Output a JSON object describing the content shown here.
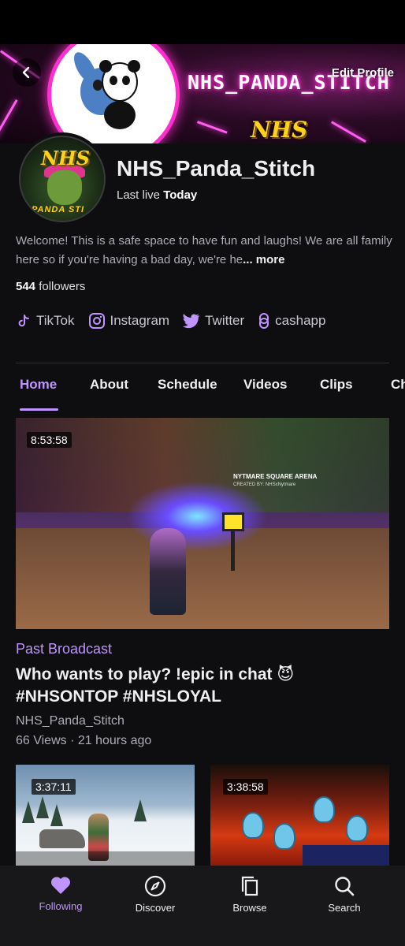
{
  "header": {
    "banner_title": "NHS_PANDA_STITCH",
    "banner_logo": "NHS",
    "back_icon": "chevron-left-icon",
    "edit_profile_label": "Edit Profile"
  },
  "channel": {
    "avatar_logo": "NHS",
    "avatar_caption": "PANDA STI",
    "name": "NHS_Panda_Stitch",
    "last_live_prefix": "Last live",
    "last_live_value": "Today",
    "bio": "Welcome! This is a safe space to have fun and laughs! We are all family here so if you're having a bad day, we're he",
    "bio_more": "... more",
    "followers_count": "544",
    "followers_label": "followers"
  },
  "socials": [
    {
      "label": "TikTok",
      "icon": "tiktok-icon"
    },
    {
      "label": "Instagram",
      "icon": "instagram-icon"
    },
    {
      "label": "Twitter",
      "icon": "twitter-icon"
    },
    {
      "label": "cashapp",
      "icon": "link-icon"
    }
  ],
  "tabs": [
    {
      "label": "Home",
      "active": true
    },
    {
      "label": "About"
    },
    {
      "label": "Schedule"
    },
    {
      "label": "Videos"
    },
    {
      "label": "Clips"
    },
    {
      "label": "Ch"
    }
  ],
  "featured_video": {
    "duration": "8:53:58",
    "overlay_title": "NYTMARE SQUARE ARENA",
    "overlay_sub": "CREATED BY: NHSxNytmare",
    "type_label": "Past Broadcast",
    "title": "Who wants to play?  !epic in chat 😈 #NHSONTOP #NHSLOYAL",
    "channel": "NHS_Panda_Stitch",
    "meta": "66 Views · 21 hours ago"
  },
  "more_videos": [
    {
      "duration": "3:37:11"
    },
    {
      "duration": "3:38:58"
    }
  ],
  "bottom_nav": [
    {
      "label": "Following",
      "icon": "heart-icon",
      "active": true
    },
    {
      "label": "Discover",
      "icon": "compass-icon"
    },
    {
      "label": "Browse",
      "icon": "browse-icon"
    },
    {
      "label": "Search",
      "icon": "search-icon"
    }
  ],
  "colors": {
    "background": "#0e0e10",
    "accent": "#bf94ff",
    "text": "#efeff1",
    "muted": "#adadb8",
    "nav_bg": "#18181b",
    "banner_neon": "#ff2fcf"
  }
}
